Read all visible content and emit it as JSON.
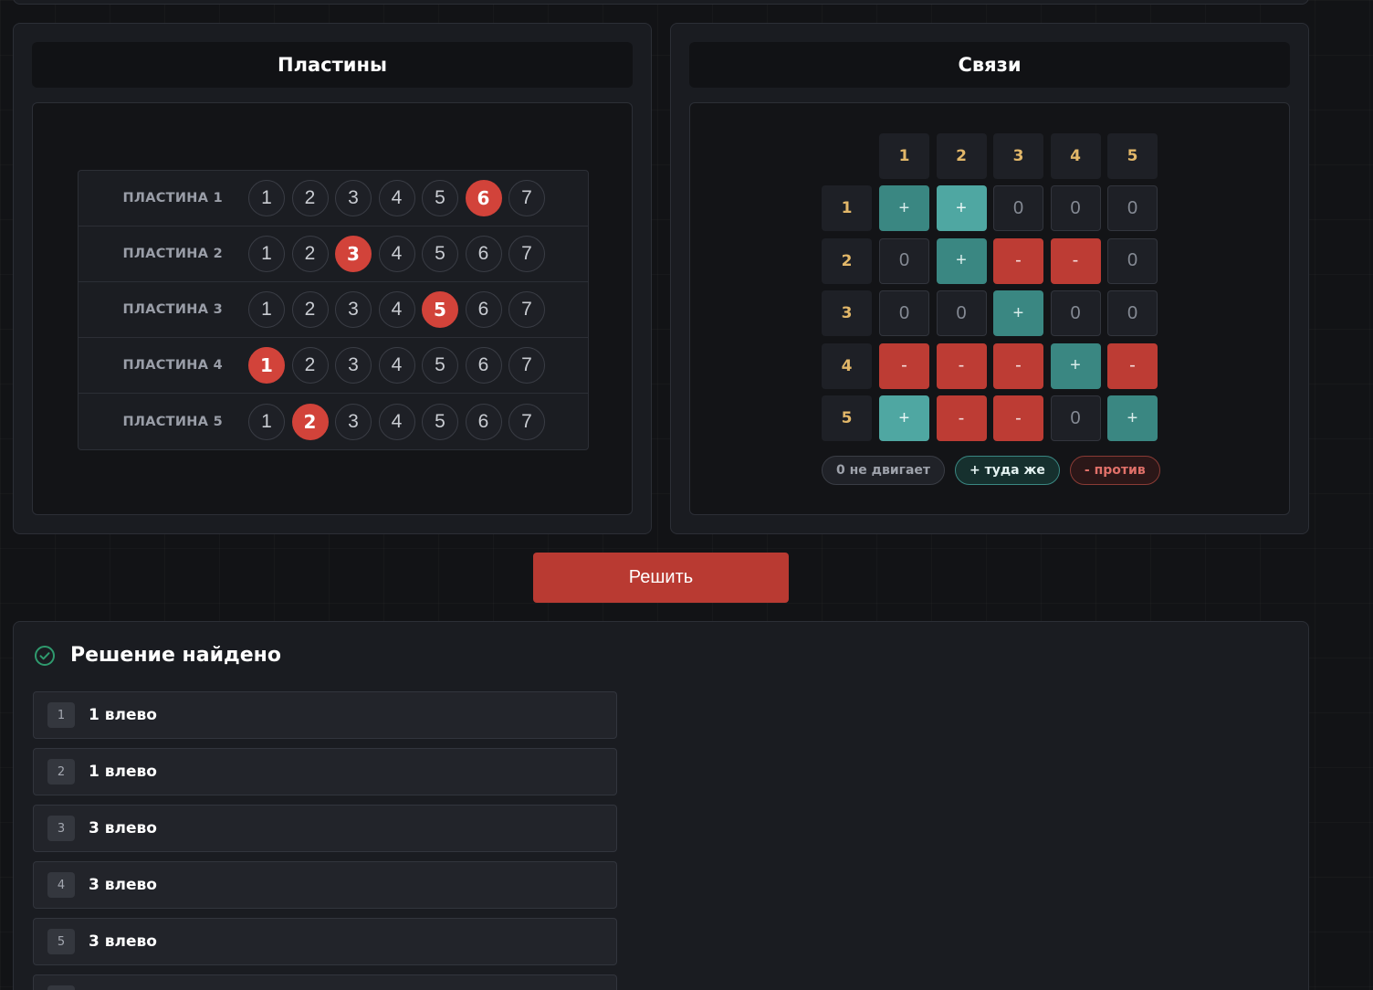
{
  "plates_panel": {
    "title": "Пластины",
    "plates": [
      {
        "label": "ПЛАСТИНА 1",
        "positions": [
          "1",
          "2",
          "3",
          "4",
          "5",
          "6",
          "7"
        ],
        "selected": 6
      },
      {
        "label": "ПЛАСТИНА 2",
        "positions": [
          "1",
          "2",
          "3",
          "4",
          "5",
          "6",
          "7"
        ],
        "selected": 3
      },
      {
        "label": "ПЛАСТИНА 3",
        "positions": [
          "1",
          "2",
          "3",
          "4",
          "5",
          "6",
          "7"
        ],
        "selected": 5
      },
      {
        "label": "ПЛАСТИНА 4",
        "positions": [
          "1",
          "2",
          "3",
          "4",
          "5",
          "6",
          "7"
        ],
        "selected": 1
      },
      {
        "label": "ПЛАСТИНА 5",
        "positions": [
          "1",
          "2",
          "3",
          "4",
          "5",
          "6",
          "7"
        ],
        "selected": 2
      }
    ]
  },
  "relations_panel": {
    "title": "Связи",
    "column_headers": [
      "1",
      "2",
      "3",
      "4",
      "5"
    ],
    "row_headers": [
      "1",
      "2",
      "3",
      "4",
      "5"
    ],
    "matrix": [
      [
        "+",
        "+",
        "0",
        "0",
        "0"
      ],
      [
        "0",
        "+",
        "-",
        "-",
        "0"
      ],
      [
        "0",
        "0",
        "+",
        "0",
        "0"
      ],
      [
        "-",
        "-",
        "-",
        "+",
        "-"
      ],
      [
        "+",
        "-",
        "-",
        "0",
        "+"
      ]
    ],
    "legend": {
      "zero": "0 не двигает",
      "plus": "+ туда же",
      "minus": "- против"
    },
    "colors": {
      "plus": "#3a8782",
      "minus": "#bd3c34",
      "zero": "#1e2026",
      "header_text": "#e2b769"
    }
  },
  "solve_button": {
    "label": "Решить",
    "color": "#b93a32"
  },
  "result": {
    "title": "Решение найдено",
    "icon": "check-circle-icon",
    "steps": [
      {
        "num": "1",
        "text": "1 влево"
      },
      {
        "num": "2",
        "text": "1 влево"
      },
      {
        "num": "3",
        "text": "3 влево"
      },
      {
        "num": "4",
        "text": "3 влево"
      },
      {
        "num": "5",
        "text": "3 влево"
      },
      {
        "num": "",
        "text": ""
      }
    ]
  }
}
